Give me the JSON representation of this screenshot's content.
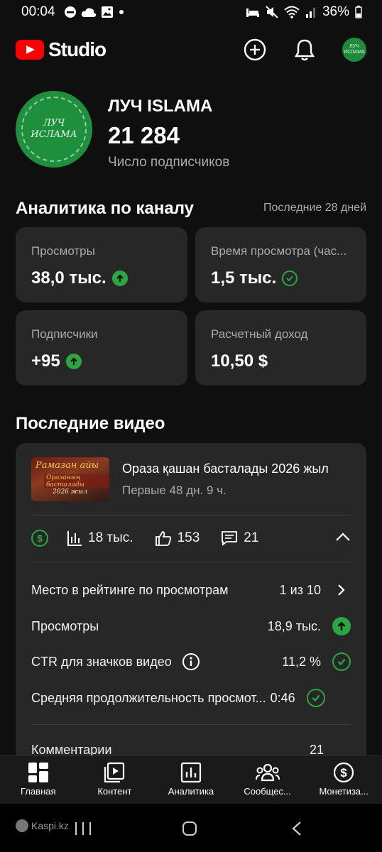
{
  "status": {
    "time": "00:04",
    "battery": "36%"
  },
  "header": {
    "brand": "Studio",
    "avatar_text": "ЛУЧ ИСЛАМА"
  },
  "channel": {
    "name": "ЛУЧ ISLAMA",
    "subscribers": "21 284",
    "subscribers_label": "Число подписчиков",
    "avatar_text_line1": "ЛУЧ",
    "avatar_text_line2": "ИСЛАМА"
  },
  "analytics": {
    "title": "Аналитика по каналу",
    "period": "Последние 28 дней",
    "cards": [
      {
        "label": "Просмотры",
        "value": "38,0 тыс.",
        "indicator": "up"
      },
      {
        "label": "Время просмотра (час...",
        "value": "1,5 тыс.",
        "indicator": "check"
      },
      {
        "label": "Подписчики",
        "value": "+95",
        "indicator": "up"
      },
      {
        "label": "Расчетный доход",
        "value": "10,50 $",
        "indicator": "none"
      }
    ]
  },
  "latest": {
    "title": "Последние видео",
    "video": {
      "title": "Ораза қашан басталады 2026 жыл",
      "subtitle": "Первые 48 дн. 9 ч.",
      "thumb_line1": "Рамазан айы",
      "thumb_line2": "Оразаның басталады",
      "thumb_line3": "2026 жыл",
      "views": "18 тыс.",
      "likes": "153",
      "comments": "21"
    },
    "metrics": [
      {
        "name": "Место в рейтинге по просмотрам",
        "value": "1 из 10",
        "icon": "chevron-right"
      },
      {
        "name": "Просмотры",
        "value": "18,9 тыс.",
        "icon": "up"
      },
      {
        "name": "CTR для значков видео",
        "value": "11,2 %",
        "icon": "check"
      },
      {
        "name": "Средняя продолжительность просмот...",
        "value": "0:46",
        "icon": "check"
      },
      {
        "name": "Комментарии",
        "value": "21",
        "icon": "none"
      }
    ]
  },
  "nav": [
    {
      "label": "Главная",
      "icon": "dashboard-icon"
    },
    {
      "label": "Контент",
      "icon": "content-icon"
    },
    {
      "label": "Аналитика",
      "icon": "analytics-icon"
    },
    {
      "label": "Сообщес...",
      "icon": "community-icon"
    },
    {
      "label": "Монетиза...",
      "icon": "monetization-icon"
    }
  ],
  "watermark": "Kaspi.kz",
  "colors": {
    "accent_green": "#2ba640",
    "brand_red": "#ff0000",
    "card_bg": "#272727",
    "bg": "#0f0f0f"
  }
}
